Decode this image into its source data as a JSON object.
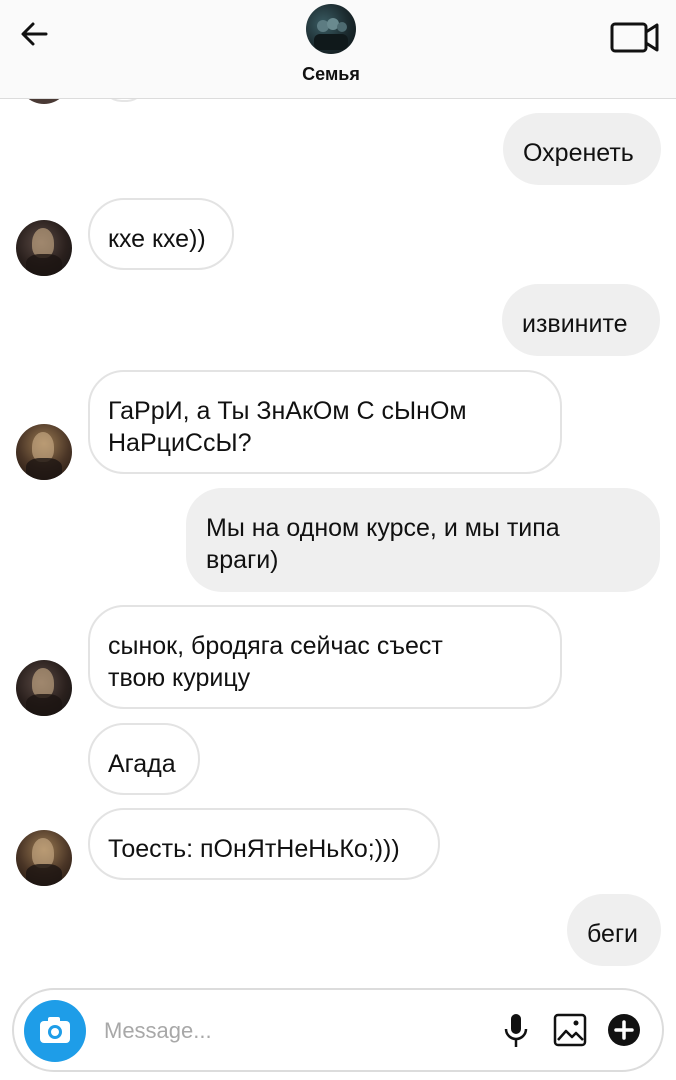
{
  "header": {
    "title": "Семья",
    "back_icon": "arrow-left-icon",
    "video_icon": "video-camera-icon"
  },
  "messages": [
    {
      "side": "out",
      "text": "Охренеть"
    },
    {
      "side": "in",
      "text": "кхе кхе))"
    },
    {
      "side": "out",
      "text": "извините"
    },
    {
      "side": "in",
      "line1": "ГаРрИ, а Ты ЗнАкОм С сЫнОм",
      "line2": "НаРциСсЫ?"
    },
    {
      "side": "out",
      "line1": "Мы на одном курсе, и мы типа",
      "line2": "враги)"
    },
    {
      "side": "in",
      "line1": "сынок, бродяга сейчас съест",
      "line2": "твою курицу"
    },
    {
      "side": "in",
      "text": "Агада"
    },
    {
      "side": "in",
      "text": "Тоесть: пОнЯтНеНьКо;)))"
    },
    {
      "side": "out",
      "text": "беги"
    }
  ],
  "composer": {
    "placeholder": "Message...",
    "camera_icon": "camera-icon",
    "mic_icon": "microphone-icon",
    "gallery_icon": "image-icon",
    "plus_icon": "plus-circle-icon"
  },
  "colors": {
    "outgoing_bubble": "#efefef",
    "incoming_border": "#e3e3e3",
    "camera_button": "#1e9de8"
  }
}
